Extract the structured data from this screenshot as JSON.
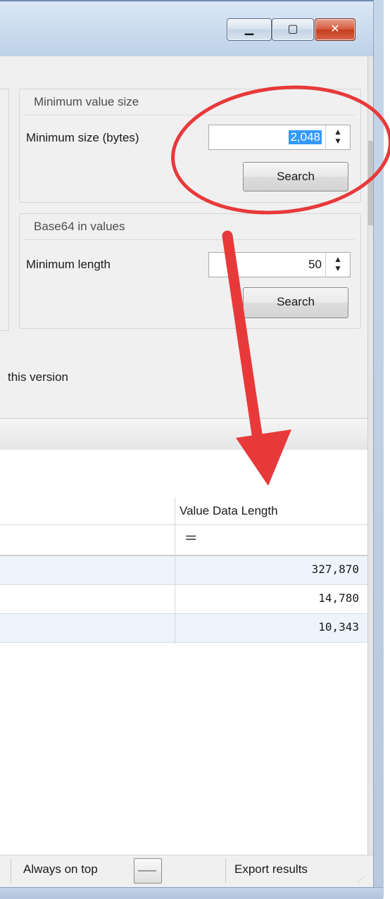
{
  "window": {
    "caption_buttons": [
      {
        "name": "minimize",
        "glyph": "▁"
      },
      {
        "name": "maximize",
        "glyph": "▢"
      },
      {
        "name": "close",
        "glyph": "✕"
      }
    ]
  },
  "min_value_group": {
    "title": "Minimum value size",
    "label": "Minimum size (bytes)",
    "value": "2,048",
    "button": "Search"
  },
  "base64_group": {
    "title": "Base64 in values",
    "label": "Minimum length",
    "value": "50",
    "button": "Search"
  },
  "info_text": "this version",
  "grid": {
    "column_header": "Value Data Length",
    "filter_symbol": "=",
    "rows": [
      {
        "value": "327,870"
      },
      {
        "value": "14,780"
      },
      {
        "value": "10,343"
      }
    ]
  },
  "statusbar": {
    "always_on_top": "Always on top",
    "export": "Export results"
  },
  "annotation": {
    "color": "#e8393a"
  }
}
